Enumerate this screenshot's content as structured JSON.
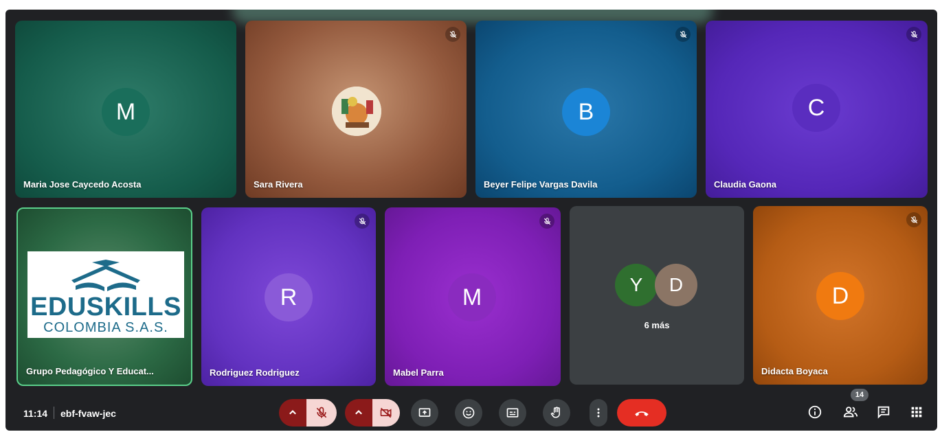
{
  "tiles": [
    {
      "name": "Maria Jose Caycedo Acosta",
      "initial": "M",
      "avatar_color": "#1a6e5b",
      "muted": false
    },
    {
      "name": "Sara Rivera",
      "initial": "",
      "muted": true
    },
    {
      "name": "Beyer Felipe Vargas Davila",
      "initial": "B",
      "avatar_color": "#1b85d6",
      "muted": true
    },
    {
      "name": "Claudia Gaona",
      "initial": "C",
      "avatar_color": "#5a2dbf",
      "muted": true
    },
    {
      "name": "Grupo Pedagógico Y Educat...",
      "logo_main": "EDUSKILLS",
      "logo_sub": "COLOMBIA S.A.S.",
      "speaking": true
    },
    {
      "name": "Rodriguez Rodriguez",
      "initial": "R",
      "avatar_color": "#8a5ad8",
      "muted": true
    },
    {
      "name": "Mabel Parra",
      "initial": "M",
      "avatar_color": "#8a2bbf",
      "muted": true
    },
    {
      "overflow_initials": [
        "Y",
        "D"
      ],
      "overflow_label": "6 más"
    },
    {
      "name": "Didacta Boyaca",
      "initial": "D",
      "avatar_color": "#f07a10",
      "muted": true
    }
  ],
  "bar": {
    "time": "11:14",
    "meeting_code": "ebf-fvaw-jec",
    "people_count": "14"
  },
  "colors": {
    "background": "#202124",
    "end_call": "#e52e23",
    "speaking_border": "#5bd08b"
  }
}
